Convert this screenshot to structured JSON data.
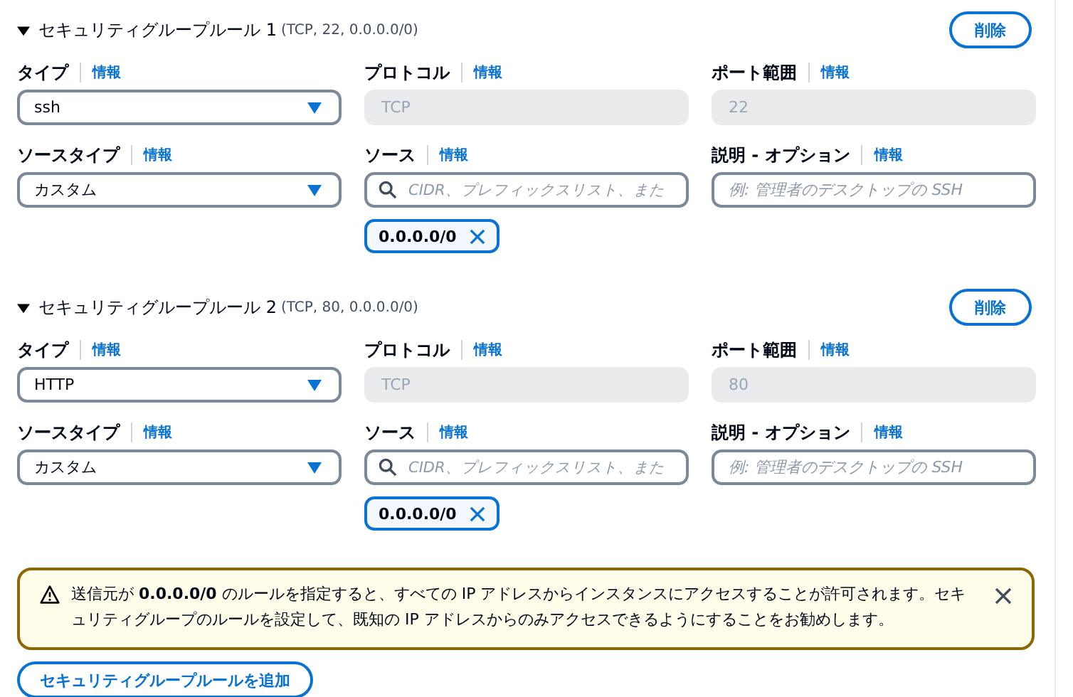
{
  "rules": [
    {
      "title": "セキュリティグループルール 1",
      "summary": "(TCP, 22, 0.0.0.0/0)",
      "expanded": true,
      "delete_button": "削除",
      "fields": [
        {
          "kind": "select",
          "label": "タイプ",
          "info": "情報",
          "value": "ssh"
        },
        {
          "kind": "readonly",
          "label": "プロトコル",
          "info": "情報",
          "value": "TCP"
        },
        {
          "kind": "readonly",
          "label": "ポート範囲",
          "info": "情報",
          "value": "22"
        },
        {
          "kind": "select",
          "label": "ソースタイプ",
          "info": "情報",
          "value": "カスタム"
        },
        {
          "kind": "search",
          "label": "ソース",
          "info": "情報",
          "placeholder": "CIDR、プレフィックスリスト、また",
          "tokens": [
            "0.0.0.0/0"
          ]
        },
        {
          "kind": "text",
          "label": "説明 - オプション",
          "info": "情報",
          "placeholder": "例: 管理者のデスクトップの SSH"
        }
      ]
    },
    {
      "title": "セキュリティグループルール 2",
      "summary": "(TCP, 80, 0.0.0.0/0)",
      "expanded": true,
      "delete_button": "削除",
      "fields": [
        {
          "kind": "select",
          "label": "タイプ",
          "info": "情報",
          "value": "HTTP"
        },
        {
          "kind": "readonly",
          "label": "プロトコル",
          "info": "情報",
          "value": "TCP"
        },
        {
          "kind": "readonly",
          "label": "ポート範囲",
          "info": "情報",
          "value": "80"
        },
        {
          "kind": "select",
          "label": "ソースタイプ",
          "info": "情報",
          "value": "カスタム"
        },
        {
          "kind": "search",
          "label": "ソース",
          "info": "情報",
          "placeholder": "CIDR、プレフィックスリスト、また",
          "tokens": [
            "0.0.0.0/0"
          ]
        },
        {
          "kind": "text",
          "label": "説明 - オプション",
          "info": "情報",
          "placeholder": "例: 管理者のデスクトップの SSH"
        }
      ]
    }
  ],
  "warning": {
    "text": "送信元が **0.0.0.0/0** のルールを指定すると、すべての IP アドレスからインスタンスにアクセスすることが許可されます。セキュリティグループのルールを設定して、既知の IP アドレスからのみアクセスできるようにすることをお勧めします。"
  },
  "add_button": "セキュリティグループルールを追加"
}
